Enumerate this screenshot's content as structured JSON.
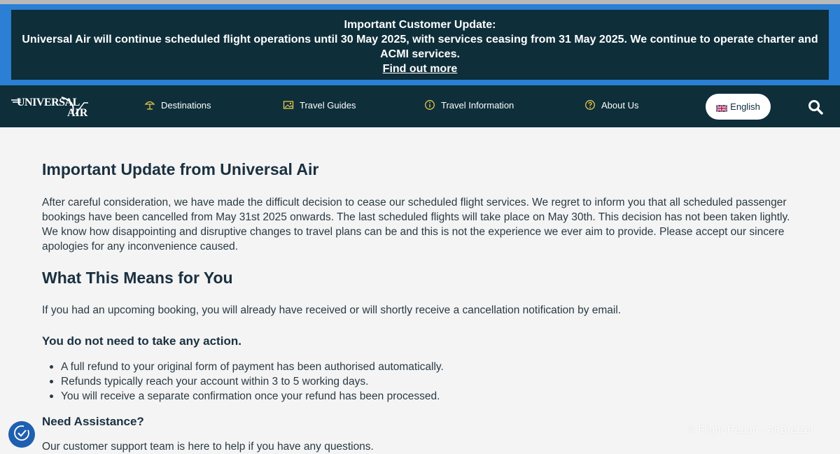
{
  "banner": {
    "title": "Important Customer Update:",
    "text": "Universal Air will continue scheduled flight operations until 30 May 2025, with services ceasing from 31 May 2025. We continue to operate charter and ACMI services.",
    "link": "Find out more"
  },
  "nav": {
    "logo_text": "UNIVERSAL AIR",
    "items": [
      {
        "label": "Destinations",
        "icon": "beach-umbrella-icon"
      },
      {
        "label": "Travel Guides",
        "icon": "image-icon"
      },
      {
        "label": "Travel Information",
        "icon": "info-circle-icon"
      },
      {
        "label": "About Us",
        "icon": "question-circle-icon"
      }
    ],
    "language": "English",
    "search_icon": "search-icon"
  },
  "main": {
    "title": "Important Update from Universal Air",
    "intro": "After careful consideration, we have made the difficult decision to cease our scheduled flight services. We regret to inform you that all scheduled passenger bookings have been cancelled from May 31st 2025 onwards. The last scheduled flights will take place on May 30th. This decision has not been taken lightly. We know how disappointing and disruptive changes to travel plans can be and this is not the experience we ever aim to provide. Please accept our sincere apologies for any inconvenience caused.",
    "means_title": "What This Means for You",
    "means_text": "If you had an upcoming booking, you will already have received or will shortly receive a cancellation notification by email.",
    "action_title": "You do not need to take any action.",
    "bullets": [
      "A full refund to your original form of payment has been authorised automatically.",
      "Refunds typically reach your account within 3 to 5 working days.",
      "You will receive a separate confirmation once your refund has been processed."
    ],
    "assist_title": "Need Assistance?",
    "assist_text": "Our customer support team is here to help if you have any questions."
  },
  "watermark": "© Flight-Report - AirBretzel",
  "colors": {
    "banner_border": "#2b7fd4",
    "navy": "#0e2e3a",
    "accent_icon": "#e8c84a",
    "cookie_button": "#1f5fb0"
  }
}
